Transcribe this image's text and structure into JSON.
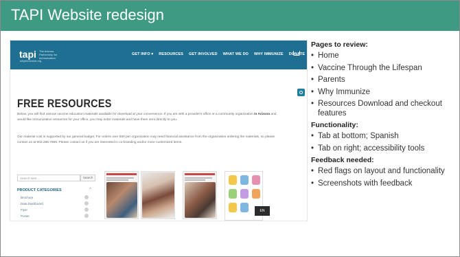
{
  "slide": {
    "title": "TAPI Website redesign"
  },
  "website": {
    "logo_text": "tapi",
    "logo_tagline": "The Arizona Partnership for Immunization",
    "logo_url": "whyimmunize.org",
    "nav": [
      "GET INFO ▾",
      "RESOURCES",
      "GET INVOLVED",
      "WHAT WE DO",
      "WHY IMMUNIZE",
      "DONATE"
    ],
    "page_heading": "FREE RESOURCES",
    "paragraph1_a": "Below, you will find various vaccine education materials available for download at your convenience. If you are with a provider's office or a community organization ",
    "paragraph1_bold": "in Arizona",
    "paragraph1_b": " and would like immunization resources for your office, you may order materials and have them sent directly to you.",
    "paragraph2": "Our material cost is supported by our general budget. For orders over 500 per organization may need financial assistance from the organization ordering the materials, so please contact us at 602.288.7568. Please contact us if you are interested in co-branding and/or more customized items.",
    "search_placeholder": "Search here ...",
    "search_button": "Search",
    "categories_heading": "PRODUCT CATEGORIES",
    "categories": [
      "Brochure",
      "Data Dashboard",
      "Flyer",
      "Poster"
    ],
    "language_button": "EN"
  },
  "sidebar": {
    "pages_heading": "Pages to review:",
    "pages": [
      "Home",
      "Vaccine Through the Lifespan",
      "Parents",
      "Why Immunize",
      "Resources Download and checkout features"
    ],
    "functionality_heading": "Functionality:",
    "functionality": [
      "Tab at bottom; Spanish",
      "Tab on right; accessibility tools"
    ],
    "feedback_heading": "Feedback needed:",
    "feedback": [
      "Red flags on layout and functionality",
      "Screenshots with feedback"
    ]
  },
  "colors": {
    "title_bar": "#3f9a84",
    "site_nav": "#1f6f93"
  }
}
